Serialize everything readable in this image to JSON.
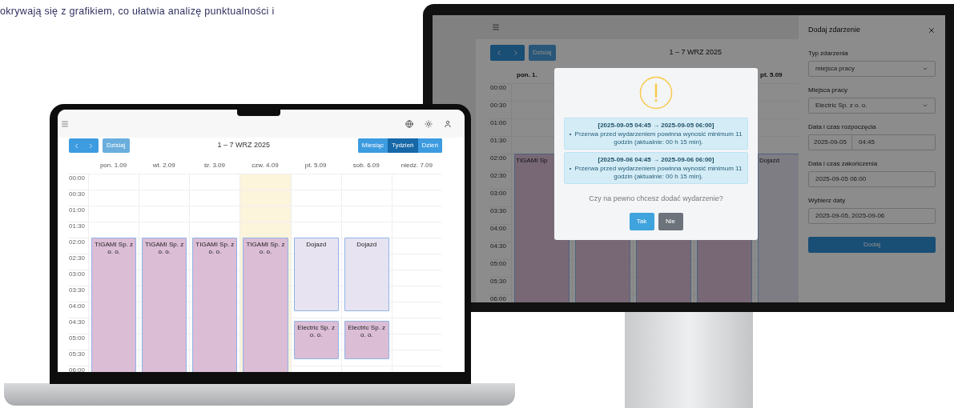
{
  "intro_text": "okrywają się z grafikiem, co ułatwia analizę punktualności i",
  "laptop": {
    "today_button": {
      "label": "Dzisiaj",
      "disabled": true
    },
    "range_title": "1 – 7 WRZ 2025",
    "view_buttons": [
      {
        "label": "Miesiąc",
        "selected": false
      },
      {
        "label": "Tydzień",
        "selected": true
      },
      {
        "label": "Dzień",
        "selected": false
      }
    ],
    "times": [
      "00:00",
      "00:30",
      "01:00",
      "01:30",
      "02:00",
      "02:30",
      "03:00",
      "03:30",
      "04:00",
      "04:30",
      "05:00",
      "05:30",
      "06:00"
    ],
    "days": [
      {
        "label": "pon. 1.09",
        "today": false,
        "events": [
          {
            "kind": "work",
            "label": "TIGAMI Sp. z o. o."
          }
        ]
      },
      {
        "label": "wt. 2.09",
        "today": false,
        "events": [
          {
            "kind": "work",
            "label": "TIGAMI Sp. z o. o."
          }
        ]
      },
      {
        "label": "śr. 3.09",
        "today": false,
        "events": [
          {
            "kind": "work",
            "label": "TIGAMI Sp. z o. o."
          }
        ]
      },
      {
        "label": "czw. 4.09",
        "today": true,
        "events": [
          {
            "kind": "work",
            "label": "TIGAMI Sp. z o. o."
          }
        ]
      },
      {
        "label": "pt. 5.09",
        "today": false,
        "events": [
          {
            "kind": "travel",
            "label": "Dojazd"
          },
          {
            "kind": "work",
            "label": "Electric Sp. z o. o."
          }
        ]
      },
      {
        "label": "sob. 6.09",
        "today": false,
        "events": [
          {
            "kind": "travel",
            "label": "Dojazd"
          },
          {
            "kind": "work",
            "label": "Electric Sp. z o. o."
          }
        ]
      },
      {
        "label": "niedz. 7.09",
        "today": false
      }
    ]
  },
  "monitor": {
    "today_button": {
      "label": "Dzisiaj",
      "disabled": true
    },
    "range_title": "1 – 7 WRZ 2025",
    "times": [
      "00:00",
      "00:30",
      "01:00",
      "01:30",
      "02:00",
      "02:30",
      "03:00",
      "03:30",
      "04:00",
      "04:30",
      "05:00",
      "05:30",
      "06:00"
    ],
    "days": [
      {
        "label": "pon. 1.",
        "events": [
          {
            "kind": "work",
            "label": "TIGAMI Sp"
          }
        ]
      },
      {
        "events": [
          {
            "kind": "work"
          }
        ]
      },
      {
        "events": [
          {
            "kind": "work"
          }
        ]
      },
      {
        "events": [
          {
            "kind": "work"
          }
        ]
      },
      {
        "label": "pt. 5.09",
        "events": [
          {
            "kind": "travel",
            "label": "Dojazd"
          }
        ]
      }
    ],
    "panel": {
      "title": "Dodaj zdarzenie",
      "fields": [
        {
          "kind": "select",
          "label": "Typ zdarzenia",
          "value": "miejsca pracy"
        },
        {
          "kind": "select",
          "label": "Miejsca pracy",
          "value": "Electric Sp. z o. o."
        },
        {
          "kind": "datetime",
          "label": "Data i czas rozpoczęcia",
          "date": "2025-09-05",
          "time": "04:45"
        },
        {
          "kind": "text",
          "label": "Data i czas zakończenia",
          "value": "2025-09-05 06:00"
        },
        {
          "kind": "text",
          "label": "Wybierz daty",
          "value": "2025-09-05, 2025-09-06"
        }
      ],
      "submit": "Dodaj"
    },
    "dialog": {
      "alerts": [
        {
          "title": "[2025-09-05 04:45 → 2025-09-05 06:00]",
          "items": [
            "Przerwa przed wydarzeniem powinna wynosić minimum 11 godzin (aktualnie: 00 h 15 min)."
          ]
        },
        {
          "title": "[2025-09-06 04:45 → 2025-09-06 06:00]",
          "items": [
            "Przerwa przed wydarzeniem powinna wynosić minimum 11 godzin (aktualnie: 00 h 15 min)."
          ]
        }
      ],
      "question": "Czy na pewno chcesz dodać wydarzenie?",
      "buttons": [
        {
          "label": "Tak",
          "kind": "primary"
        },
        {
          "label": "Nie",
          "kind": "secondary"
        }
      ]
    }
  }
}
